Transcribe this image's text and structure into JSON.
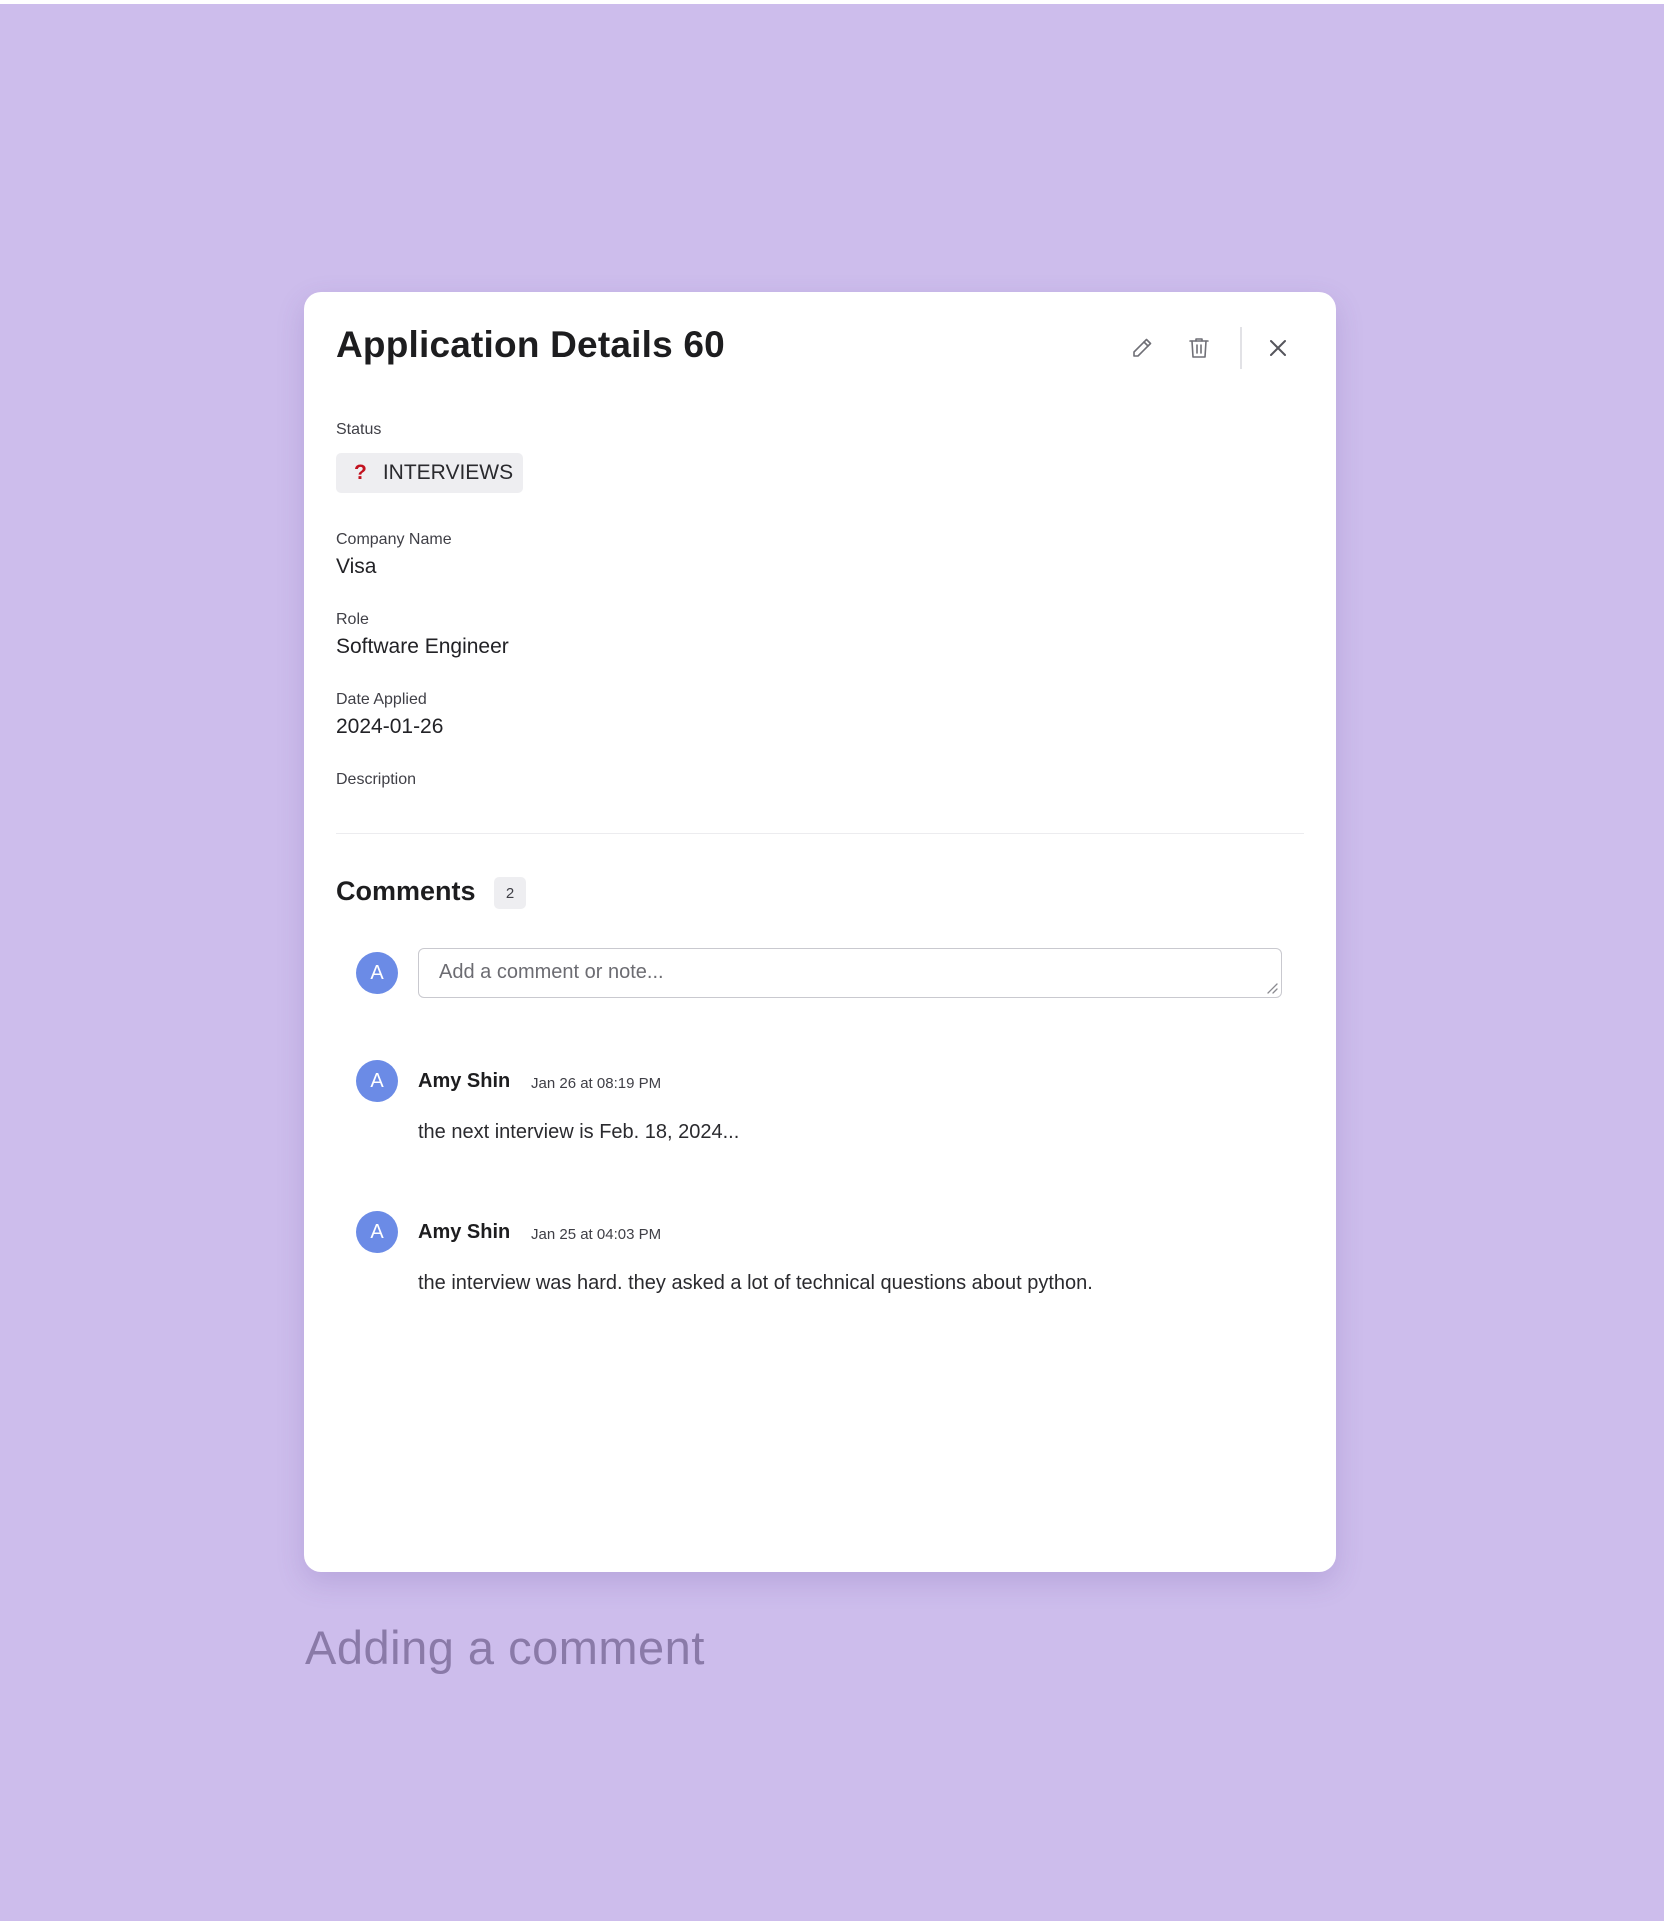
{
  "modal": {
    "title": "Application Details 60",
    "actions": {
      "edit_icon": "pencil-icon",
      "delete_icon": "trash-icon",
      "close_icon": "close-icon"
    }
  },
  "fields": {
    "status_label": "Status",
    "status_value": "INTERVIEWS",
    "status_icon": "?",
    "status_icon_color": "#c2121f",
    "company_label": "Company Name",
    "company_value": "Visa",
    "role_label": "Role",
    "role_value": "Software Engineer",
    "date_label": "Date Applied",
    "date_value": "2024-01-26",
    "description_label": "Description"
  },
  "comments": {
    "title": "Comments",
    "count": "2",
    "input_avatar": "A",
    "input_placeholder": "Add a comment or note...",
    "items": [
      {
        "avatar": "A",
        "author": "Amy Shin",
        "time": "Jan 26 at 08:19 PM",
        "text": "the next interview is Feb. 18, 2024..."
      },
      {
        "avatar": "A",
        "author": "Amy Shin",
        "time": "Jan 25 at 04:03 PM",
        "text": "the interview was hard. they asked a lot of technical questions about python."
      }
    ]
  },
  "caption": "Adding a comment",
  "colors": {
    "background": "#cdbdec",
    "avatar": "#6b8be6",
    "caption": "#8a7aa8"
  }
}
